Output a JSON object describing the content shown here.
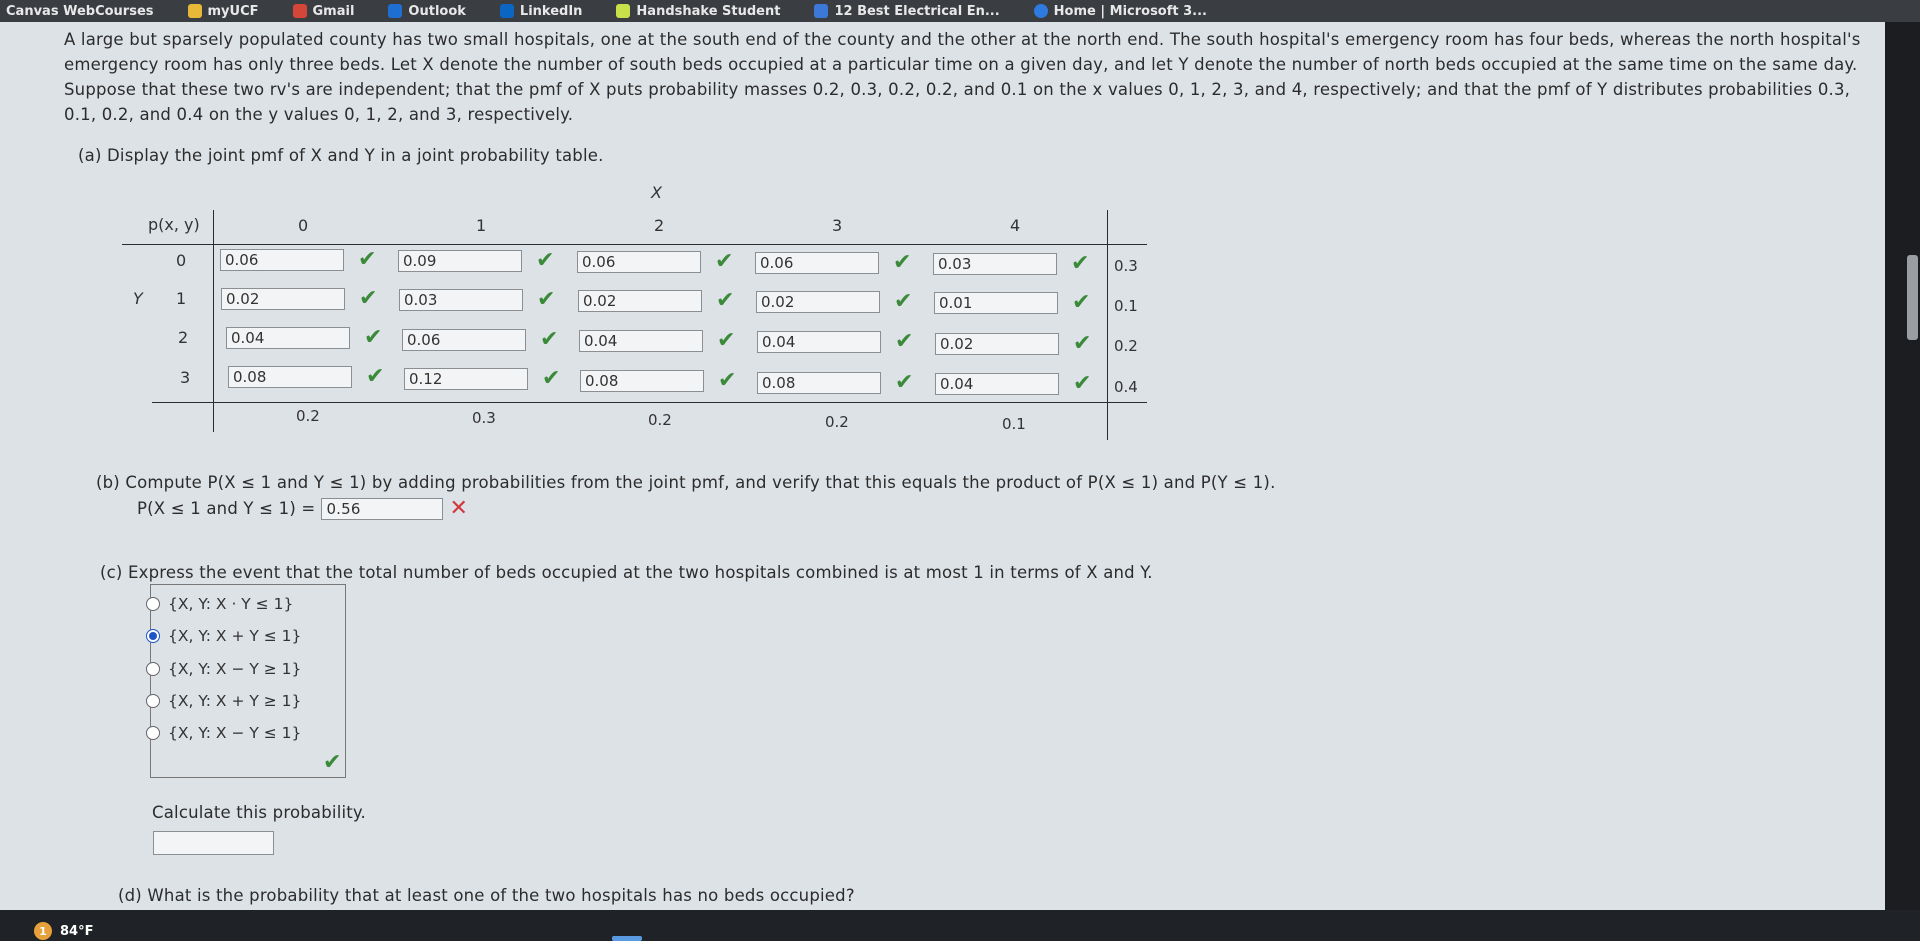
{
  "bookmarks": [
    "Canvas WebCourses",
    "myUCF",
    "Gmail",
    "Outlook",
    "LinkedIn",
    "Handshake Student",
    "12 Best Electrical En...",
    "Home | Microsoft 3..."
  ],
  "problem": "A large but sparsely populated county has two small hospitals, one at the south end of the county and the other at the north end. The south hospital's emergency room has four beds, whereas the north hospital's emergency room has only three beds. Let X denote the number of south beds occupied at a particular time on a given day, and let Y denote the number of north beds occupied at the same time on the same day. Suppose that these two rv's are independent; that the pmf of X puts probability masses 0.2, 0.3, 0.2, 0.2, and 0.1 on the x values 0, 1, 2, 3, and 4, respectively; and that the pmf of Y distributes probabilities 0.3, 0.1, 0.2, and 0.4 on the y values 0, 1, 2, and 3, respectively.",
  "part_a": "(a)  Display the joint pmf of X and Y in a joint probability table.",
  "table": {
    "x_label": "X",
    "y_label": "Y",
    "corner": "p(x, y)",
    "x_values": [
      "0",
      "1",
      "2",
      "3",
      "4"
    ],
    "y_values": [
      "0",
      "1",
      "2",
      "3"
    ],
    "cells": [
      [
        "0.06",
        "0.09",
        "0.06",
        "0.06",
        "0.03"
      ],
      [
        "0.02",
        "0.03",
        "0.02",
        "0.02",
        "0.01"
      ],
      [
        "0.04",
        "0.06",
        "0.04",
        "0.04",
        "0.02"
      ],
      [
        "0.08",
        "0.12",
        "0.08",
        "0.08",
        "0.04"
      ]
    ],
    "row_margins": [
      "0.3",
      "0.1",
      "0.2",
      "0.4"
    ],
    "col_margins": [
      "0.2",
      "0.3",
      "0.2",
      "0.2",
      "0.1"
    ]
  },
  "part_b": "(b)  Compute P(X ≤ 1 and Y ≤ 1) by adding probabilities from the joint pmf, and verify that this equals the product of P(X ≤ 1) and P(Y ≤ 1).",
  "part_b_label": "P(X ≤ 1 and Y ≤ 1) =",
  "part_b_value": "0.56",
  "part_c": "(c)  Express the event that the total number of beds occupied at the two hospitals combined is at most 1 in terms of X and Y.",
  "options": [
    "{X, Y: X · Y ≤ 1}",
    "{X, Y: X + Y ≤ 1}",
    "{X, Y: X − Y ≥ 1}",
    "{X, Y: X + Y ≥ 1}",
    "{X, Y: X − Y ≤ 1}"
  ],
  "selected_option": 1,
  "calc_label": "Calculate this probability.",
  "calc_value": "",
  "part_d": "(d)  What is the probability that at least one of the two hospitals has no beds occupied?",
  "weather": "84°F",
  "icons": {
    "correct": "check-icon",
    "incorrect": "x-icon",
    "radio": "radio-icon"
  }
}
